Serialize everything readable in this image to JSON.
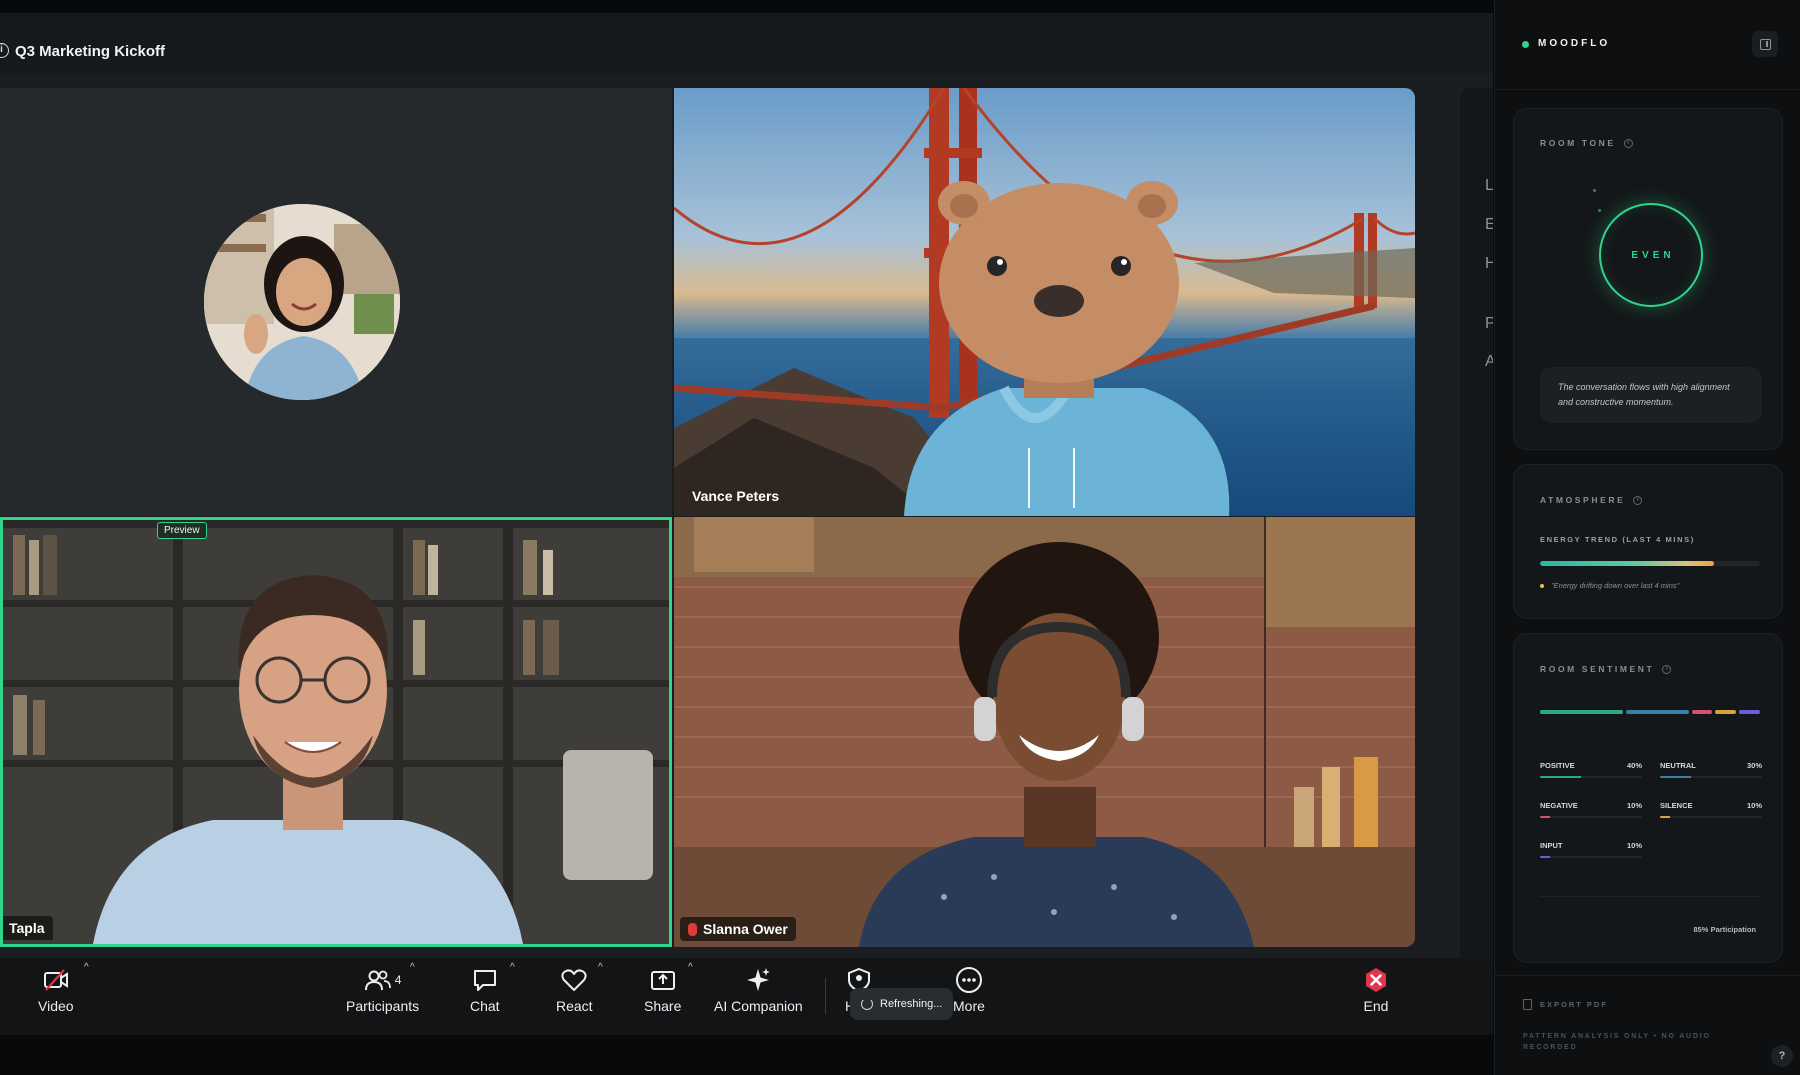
{
  "meeting": {
    "title": "Q3 Marketing Kickoff",
    "preview_badge": "Preview",
    "participants": [
      {
        "name": ""
      },
      {
        "name": "Vance Peters"
      },
      {
        "name": "Tapla"
      },
      {
        "name": "Slanna Ower"
      }
    ]
  },
  "side_strip_letters": [
    "L",
    "E",
    "H",
    "P",
    "A"
  ],
  "toolbar": {
    "video_label": "Video",
    "participants_label": "Participants",
    "participants_count": "4",
    "chat_label": "Chat",
    "react_label": "React",
    "share_label": "Share",
    "ai_label": "AI Companion",
    "hidden_label": "H",
    "refreshing_label": "Refreshing...",
    "more_label": "More",
    "end_label": "End",
    "colors": {
      "end": "#e0354b",
      "accent": "#2fd58a"
    }
  },
  "moodflo": {
    "brand": "MOODFLO",
    "room_tone": {
      "title": "ROOM TONE",
      "state": "EVEN",
      "summary": "The conversation flows with high alignment and constructive momentum."
    },
    "atmosphere": {
      "title": "ATMOSPHERE",
      "energy_label": "ENERGY TREND (LAST 4 MINS)",
      "energy_level": 0.79,
      "energy_note": "\"Energy drifting down over last 4 mins\""
    },
    "sentiment": {
      "title": "ROOM SENTIMENT",
      "items": [
        {
          "label": "POSITIVE",
          "value": "40%",
          "pct": 40,
          "color": "#2aa88a"
        },
        {
          "label": "NEUTRAL",
          "value": "30%",
          "pct": 30,
          "color": "#3d7ea6"
        },
        {
          "label": "NEGATIVE",
          "value": "10%",
          "pct": 10,
          "color": "#d4516b"
        },
        {
          "label": "SILENCE",
          "value": "10%",
          "pct": 10,
          "color": "#d9a33c"
        },
        {
          "label": "INPUT",
          "value": "10%",
          "pct": 10,
          "color": "#6a5fd8"
        }
      ],
      "participation": "85% Participation"
    },
    "export_label": "EXPORT PDF",
    "footer_note": "PATTERN ANALYSIS ONLY • NO AUDIO RECORDED",
    "help_label": "?"
  }
}
